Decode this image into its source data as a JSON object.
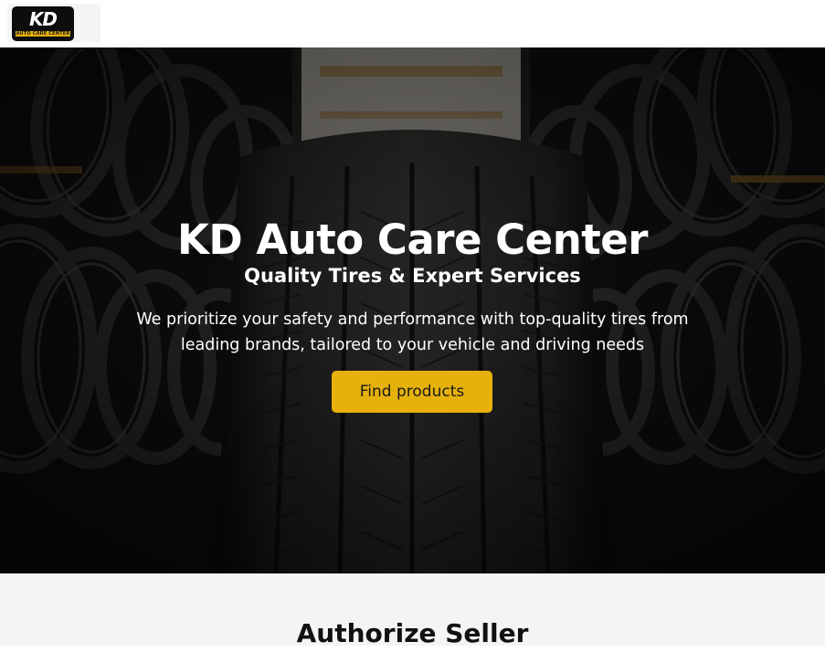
{
  "header": {
    "logo": {
      "main_text": "KD",
      "sub_text": "AUTO CARE CENTER"
    }
  },
  "hero": {
    "title": "KD Auto Care Center",
    "subtitle": "Quality Tires & Expert Services",
    "description": "We prioritize your safety and performance with top-quality tires from leading brands, tailored to your vehicle and driving needs",
    "cta_label": "Find products"
  },
  "authorized_section": {
    "title": "Authorize Seller"
  },
  "colors": {
    "accent": "#e6b10a",
    "hero_overlay": "#1b1a18",
    "section_bg": "#f3f4f6",
    "heading_text": "#111111"
  }
}
